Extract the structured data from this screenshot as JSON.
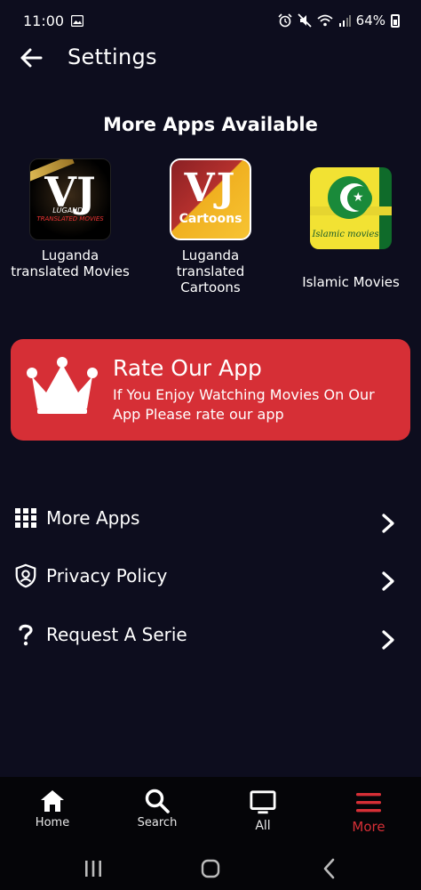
{
  "status": {
    "time": "11:00",
    "battery": "64%"
  },
  "header": {
    "title": "Settings"
  },
  "more_apps": {
    "title": "More Apps Available",
    "apps": [
      {
        "label": "Luganda translated Movies",
        "icon_text": "VJ",
        "icon_sub1": "LUGANDA",
        "icon_sub2": "TRANSLATED MOVIES"
      },
      {
        "label": "Luganda translated Cartoons",
        "icon_text": "VJ",
        "icon_sub": "Cartoons"
      },
      {
        "label": "Islamic Movies",
        "icon_text": "Islamic movies"
      }
    ]
  },
  "rate": {
    "title": "Rate Our App",
    "subtitle": "If You Enjoy Watching Movies On Our App Please rate our app"
  },
  "menu": [
    {
      "label": "More Apps",
      "icon": "grid-icon"
    },
    {
      "label": "Privacy Policy",
      "icon": "shield-icon"
    },
    {
      "label": "Request A Serie",
      "icon": "question-icon"
    }
  ],
  "nav": [
    {
      "label": "Home",
      "icon": "home-icon"
    },
    {
      "label": "Search",
      "icon": "search-icon"
    },
    {
      "label": "All",
      "icon": "tv-icon"
    },
    {
      "label": "More",
      "icon": "menu-icon",
      "active": true
    }
  ],
  "colors": {
    "background": "#0d0d1e",
    "accent": "#d62f36",
    "nav_background": "#050508"
  }
}
